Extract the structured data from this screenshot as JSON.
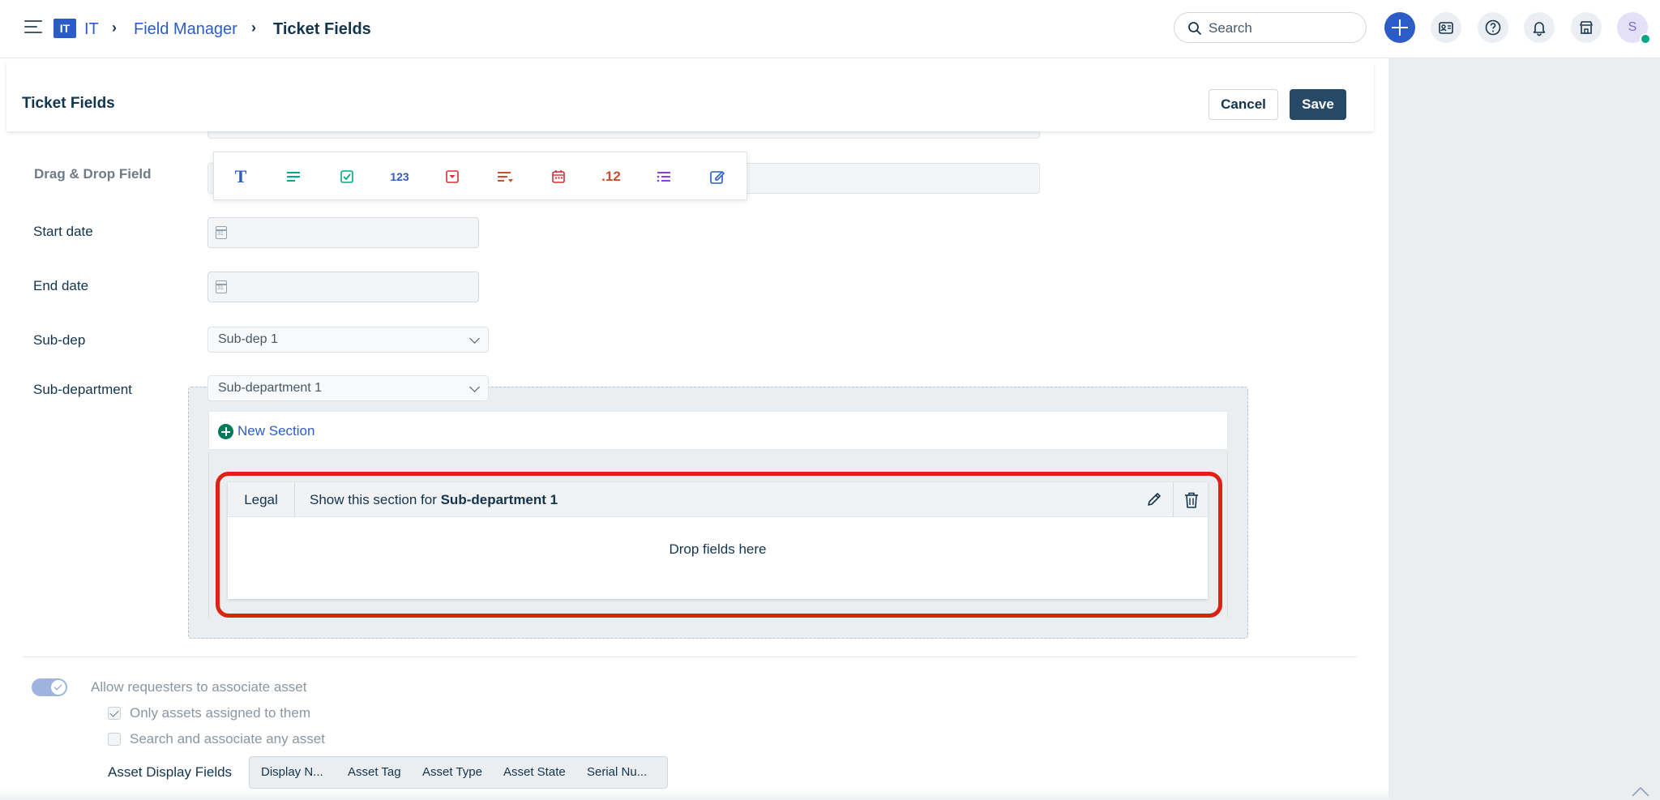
{
  "topbar": {
    "workspace_badge": "IT",
    "breadcrumb": [
      "IT",
      "Field Manager",
      "Ticket Fields"
    ],
    "search_placeholder": "Search",
    "avatar_initial": "S"
  },
  "subheader": {
    "title": "Ticket Fields",
    "cancel_label": "Cancel",
    "save_label": "Save"
  },
  "drag_drop": {
    "label": "Drag & Drop Field",
    "tools": [
      {
        "icon": "text-field-icon",
        "glyph": "T",
        "color": "#2c5cc5"
      },
      {
        "icon": "paragraph-field-icon",
        "glyph": "",
        "color": "#00a886"
      },
      {
        "icon": "checkbox-field-icon",
        "glyph": "",
        "color": "#00a886"
      },
      {
        "icon": "number-field-icon",
        "glyph": "123",
        "color": "#2c5cc5"
      },
      {
        "icon": "dropdown-field-icon",
        "glyph": "",
        "color": "#d72d30"
      },
      {
        "icon": "dependent-field-icon",
        "glyph": "",
        "color": "#c7502c"
      },
      {
        "icon": "date-field-icon",
        "glyph": "",
        "color": "#d72d30"
      },
      {
        "icon": "decimal-field-icon",
        "glyph": ".12",
        "color": "#c7502c"
      },
      {
        "icon": "multi-select-field-icon",
        "glyph": "",
        "color": "#8c3fd6"
      },
      {
        "icon": "custom-field-icon",
        "glyph": "",
        "color": "#2c5cc5"
      }
    ]
  },
  "fields": {
    "start_date": "Start date",
    "end_date": "End date",
    "sub_dep_label": "Sub-dep",
    "sub_dep_value": "Sub-dep 1",
    "sub_department_label": "Sub-department",
    "sub_department_value": "Sub-department 1"
  },
  "sections": {
    "new_section_label": "New Section",
    "items": [
      {
        "name": "Legal",
        "condition_prefix": "Show this section for",
        "condition_value": "Sub-department 1",
        "drop_text": "Drop fields here"
      }
    ]
  },
  "asset": {
    "toggle_label": "Allow requesters to associate asset",
    "option_assigned": "Only assets assigned to them",
    "option_any": "Search and associate any asset",
    "display_fields_label": "Asset Display Fields",
    "display_fields": [
      "Display N...",
      "Asset Tag",
      "Asset Type",
      "Asset State",
      "Serial Nu..."
    ]
  },
  "colors": {
    "primary": "#2c5cc5",
    "save_button": "#264966",
    "highlight": "#dd2214",
    "online": "#00a886"
  }
}
